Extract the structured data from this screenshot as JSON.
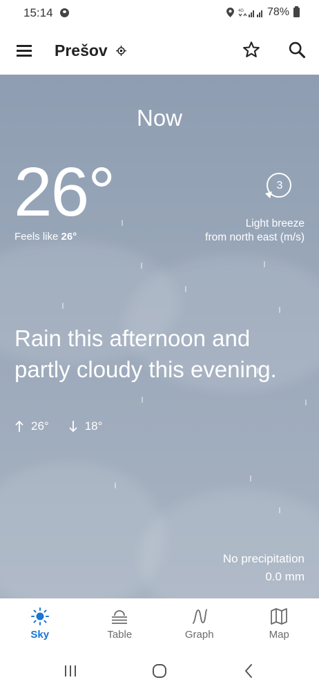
{
  "status_bar": {
    "time": "15:14",
    "network": "4G",
    "battery": "78%"
  },
  "header": {
    "city": "Prešov",
    "icons": [
      "menu-icon",
      "location-target-icon",
      "star-icon",
      "search-icon"
    ]
  },
  "now": {
    "title": "Now",
    "temperature": "26°",
    "feels_like_label": "Feels like",
    "feels_like_value": "26°",
    "wind": {
      "speed": "3",
      "line1": "Light breeze",
      "line2": "from north east (m/s)"
    },
    "summary": "Rain this afternoon and partly cloudy this evening.",
    "high": "26°",
    "low": "18°",
    "precipitation": {
      "label": "No precipitation",
      "value": "0.0 mm"
    }
  },
  "bottom_nav": {
    "items": [
      {
        "label": "Sky",
        "icon": "sun-icon",
        "active": true
      },
      {
        "label": "Table",
        "icon": "table-icon",
        "active": false
      },
      {
        "label": "Graph",
        "icon": "graph-icon",
        "active": false
      },
      {
        "label": "Map",
        "icon": "map-icon",
        "active": false
      }
    ]
  },
  "colors": {
    "accent": "#1976d2",
    "sky_top": "#8e9db1",
    "sky_bottom": "#a7b3c2"
  }
}
